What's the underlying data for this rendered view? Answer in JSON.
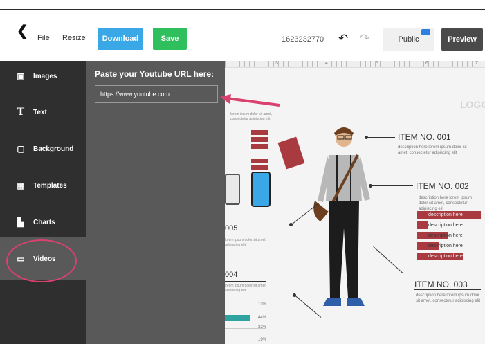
{
  "toolbar": {
    "back_icon": "chevron-left-icon",
    "file_label": "File",
    "resize_label": "Resize",
    "download_label": "Download",
    "save_label": "Save",
    "doc_id": "1623232770",
    "undo_icon": "undo-icon",
    "redo_icon": "redo-icon",
    "public_label": "Public",
    "preview_label": "Preview"
  },
  "sidebar": {
    "items": [
      {
        "label": "Images",
        "icon": "image-icon",
        "glyph": "▣"
      },
      {
        "label": "Text",
        "icon": "text-icon",
        "glyph": "T"
      },
      {
        "label": "Background",
        "icon": "background-icon",
        "glyph": "▢"
      },
      {
        "label": "Templates",
        "icon": "templates-icon",
        "glyph": "▦"
      },
      {
        "label": "Charts",
        "icon": "charts-icon",
        "glyph": "▙"
      },
      {
        "label": "Videos",
        "icon": "video-icon",
        "glyph": "▭"
      }
    ]
  },
  "panel": {
    "title": "Paste your Youtube URL here:",
    "url_value": "https://www.youtube.com",
    "close_glyph": "×"
  },
  "canvas": {
    "logo": "LOGO",
    "ruler_numbers": [
      "3",
      "4",
      "5",
      "6",
      "7"
    ],
    "items": [
      {
        "title": "ITEM NO. 001",
        "desc": "description here lorem ipsum dolor sit amet, consectetur adipiscing elit"
      },
      {
        "title": "ITEM NO. 002",
        "desc": "description here lorem ipsum dolor sit amet, consectetur adipiscing elit"
      },
      {
        "title": "ITEM NO. 003",
        "desc": "description here lorem ipsum dolor sit amet, consectetur adipiscing elit"
      }
    ],
    "desc_bars": [
      "description here",
      "description here",
      "description here",
      "description here",
      "description here"
    ],
    "left_numbers": [
      "005",
      "004"
    ],
    "left_small_top": "lorem ipsum dolor sit amet, consectetur adipiscing elit",
    "left_small_005": "lorem ipsum dolor sit amet, adipiscing elit",
    "left_small_004": "lorem ipsum dolor sit amet, adipiscing elit",
    "percentages": [
      "13%",
      "44%",
      "32%",
      "19%"
    ]
  },
  "colors": {
    "accent_download": "#3aa8e6",
    "accent_save": "#2fbf5c",
    "sidebar_bg": "#2f2f2f",
    "panel_bg": "#595959",
    "highlight_circle": "#d9416e",
    "infographic_red": "#a83a40"
  }
}
